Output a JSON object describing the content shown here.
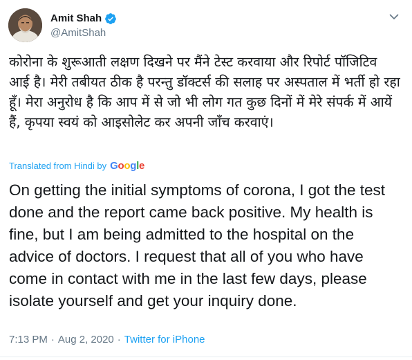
{
  "tweet": {
    "display_name": "Amit Shah",
    "handle": "@AmitShah",
    "verified": true,
    "hindi_text": "कोरोना के शुरूआती लक्षण दिखने पर मैंने टेस्ट करवाया और रिपोर्ट पॉजिटिव आई है। मेरी तबीयत ठीक है परन्तु डॉक्टर्स की सलाह पर अस्पताल में भर्ती हो रहा हूँ। मेरा अनुरोध है कि आप में से जो भी लोग गत कुछ दिनों में मेरे संपर्क में आयें हैं, कृपया स्वयं को आइसोलेट कर अपनी जाँच करवाएं।",
    "translated_label": "Translated from Hindi by",
    "google_logo": "Google",
    "english_text": "On getting the initial symptoms of corona, I got the test done and the report came back positive. My health is fine, but I am being admitted to the hospital on the advice of doctors. I request that all of you who have come in contact with me in the last few days, please isolate yourself and get your inquiry done.",
    "time": "7:13 PM",
    "date": "Aug 2, 2020",
    "separator": "·",
    "source": "Twitter for iPhone"
  },
  "icons": {
    "verified": "verified-badge-icon",
    "menu": "chevron-down-icon"
  },
  "colors": {
    "accent": "#1da1f2",
    "text": "#14171a",
    "secondary": "#657786",
    "divider": "#e6ecf0"
  }
}
